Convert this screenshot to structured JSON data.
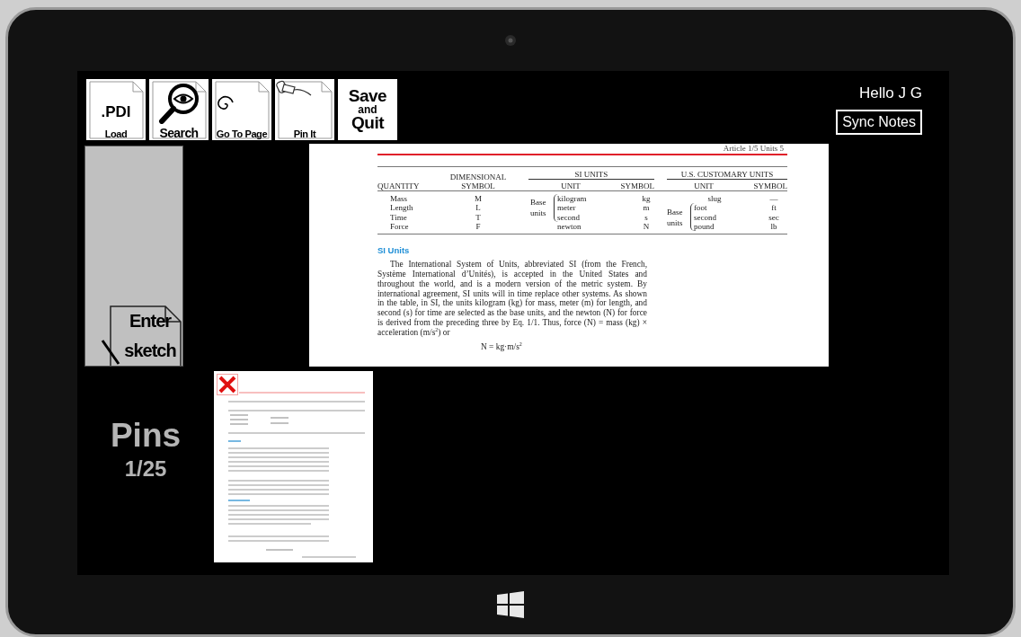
{
  "toolbar": [
    {
      "kind": "load",
      "texts": [
        ".PDI",
        "Load"
      ]
    },
    {
      "kind": "search",
      "texts": [
        "Search"
      ]
    },
    {
      "kind": "goto",
      "texts": [
        "Go To Page"
      ]
    },
    {
      "kind": "pin",
      "texts": [
        "Pin It"
      ]
    },
    {
      "kind": "save",
      "texts": [
        "Save",
        "and",
        "Quit"
      ]
    }
  ],
  "greeting": "Hello J G",
  "sync_button": "Sync Notes",
  "sketch_button": [
    "Enter",
    "sketch"
  ],
  "pins": {
    "title": "Pins",
    "count": "1/25"
  },
  "document": {
    "running_head": "Article 1/5  Units  5",
    "table": {
      "groups": [
        "SI UNITS",
        "U.S. CUSTOMARY UNITS"
      ],
      "columns": [
        "QUANTITY",
        "DIMENSIONAL SYMBOL",
        "UNIT",
        "SYMBOL",
        "UNIT",
        "SYMBOL"
      ],
      "si_base_label": "Base units",
      "us_base_label": "Base units",
      "rows": [
        {
          "quantity": "Mass",
          "dimension": "M",
          "si_unit": "kilogram",
          "si_symbol": "kg",
          "si_base": true,
          "us_unit": "slug",
          "us_symbol": "—",
          "us_base": false
        },
        {
          "quantity": "Length",
          "dimension": "L",
          "si_unit": "meter",
          "si_symbol": "m",
          "si_base": true,
          "us_unit": "foot",
          "us_symbol": "ft",
          "us_base": true
        },
        {
          "quantity": "Time",
          "dimension": "T",
          "si_unit": "second",
          "si_symbol": "s",
          "si_base": true,
          "us_unit": "second",
          "us_symbol": "sec",
          "us_base": true
        },
        {
          "quantity": "Force",
          "dimension": "F",
          "si_unit": "newton",
          "si_symbol": "N",
          "si_base": false,
          "us_unit": "pound",
          "us_symbol": "lb",
          "us_base": true
        }
      ]
    },
    "heading": "SI Units",
    "paragraph": "The International System of Units, abbreviated SI (from the French, Système International d’Unités), is accepted in the United States and throughout the world, and is a modern version of the metric system. By international agreement, SI units will in time replace other systems. As shown in the table, in SI, the units kilogram (kg) for mass, meter (m) for length, and second (s) for time are selected as the base units, and the newton (N) for force is derived from the preceding three by Eq. 1/1. Thus, force (N) = mass (kg) × acceleration (m/s$^{2}$) or",
    "equation": "N = kg·m/s$^{2}$"
  }
}
